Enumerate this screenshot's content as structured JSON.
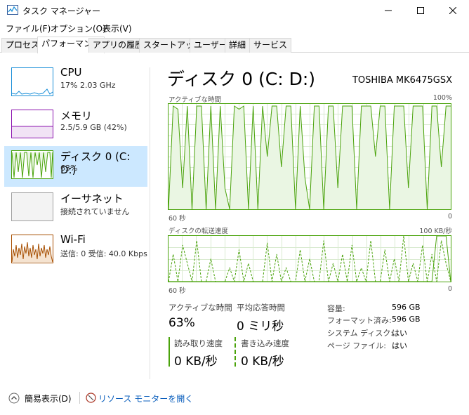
{
  "window": {
    "title": "タスク マネージャー"
  },
  "menu": [
    "ファイル(F)",
    "オプション(O)",
    "表示(V)"
  ],
  "tabs": [
    "プロセス",
    "パフォーマンス",
    "アプリの履歴",
    "スタートアップ",
    "ユーザー",
    "詳細",
    "サービス"
  ],
  "sidebar": {
    "items": [
      {
        "name": "CPU",
        "sub": "17%  2.03 GHz",
        "color": "#1a8fd8"
      },
      {
        "name": "メモリ",
        "sub": "2.5/5.9 GB (42%)",
        "color": "#8b12ae"
      },
      {
        "name": "ディスク 0 (C: D:)",
        "sub": "63%",
        "color": "#4aa30b"
      },
      {
        "name": "イーサネット",
        "sub": "接続されていません",
        "color": "#a0a0a0"
      },
      {
        "name": "Wi-Fi",
        "sub": "送信: 0  受信: 40.0 Kbps",
        "color": "#a74f01"
      }
    ]
  },
  "main": {
    "title": "ディスク 0 (C: D:)",
    "model": "TOSHIBA MK6475GSX",
    "graph1": {
      "label": "アクティブな時間",
      "max": "100%",
      "left": "60 秒",
      "right": "0"
    },
    "graph2": {
      "label": "ディスクの転送速度",
      "max": "100 KB/秒",
      "left": "60 秒",
      "right": "0"
    },
    "stats": {
      "active_label": "アクティブな時間",
      "active_value": "63%",
      "resp_label": "平均応答時間",
      "resp_value": "0 ミリ秒",
      "read_label": "読み取り速度",
      "read_value": "0 KB/秒",
      "write_label": "書き込み速度",
      "write_value": "0 KB/秒"
    },
    "info": [
      {
        "k": "容量:",
        "v": "596 GB"
      },
      {
        "k": "フォーマット済み:",
        "v": "596 GB"
      },
      {
        "k": "システム ディスク:",
        "v": "はい"
      },
      {
        "k": "ページ ファイル:",
        "v": "はい"
      }
    ]
  },
  "footer": {
    "fewer_details": "簡易表示(D)",
    "resource_monitor": "リソース モニターを開く"
  },
  "series": {
    "active_time": [
      0,
      98,
      95,
      20,
      98,
      0,
      98,
      98,
      0,
      98,
      0,
      98,
      20,
      0,
      98,
      95,
      98,
      0,
      98,
      0,
      98,
      50,
      98,
      98,
      40,
      98,
      98,
      0,
      98,
      30,
      0,
      98,
      98,
      0,
      98,
      98,
      20,
      98,
      98,
      98,
      0,
      98,
      98,
      98,
      50,
      98,
      98,
      0,
      98,
      98,
      98,
      20,
      98,
      98,
      98,
      0,
      98,
      98,
      40,
      98,
      98
    ],
    "transfer_solid": [
      0,
      0,
      0,
      0,
      0,
      0,
      0,
      0,
      0,
      0,
      0,
      0,
      0,
      0,
      0,
      0,
      0,
      0,
      0,
      0,
      0,
      0,
      0,
      0,
      0,
      0,
      0,
      0,
      0,
      0,
      0,
      0,
      0,
      0,
      0,
      0,
      0,
      0,
      0,
      0,
      0,
      0,
      0,
      0,
      0,
      0,
      0,
      0,
      0,
      0,
      0,
      0,
      0,
      0,
      0,
      0,
      0,
      100,
      100,
      100,
      0
    ],
    "transfer_dash": [
      0,
      60,
      0,
      80,
      40,
      0,
      90,
      0,
      0,
      50,
      0,
      0,
      0,
      30,
      0,
      70,
      0,
      40,
      0,
      0,
      0,
      85,
      0,
      60,
      0,
      30,
      0,
      0,
      70,
      0,
      50,
      0,
      0,
      90,
      0,
      40,
      0,
      60,
      0,
      80,
      0,
      30,
      0,
      90,
      0,
      0,
      70,
      0,
      50,
      0,
      100,
      0,
      40,
      0,
      80,
      0,
      60,
      0,
      90,
      40,
      0
    ]
  }
}
